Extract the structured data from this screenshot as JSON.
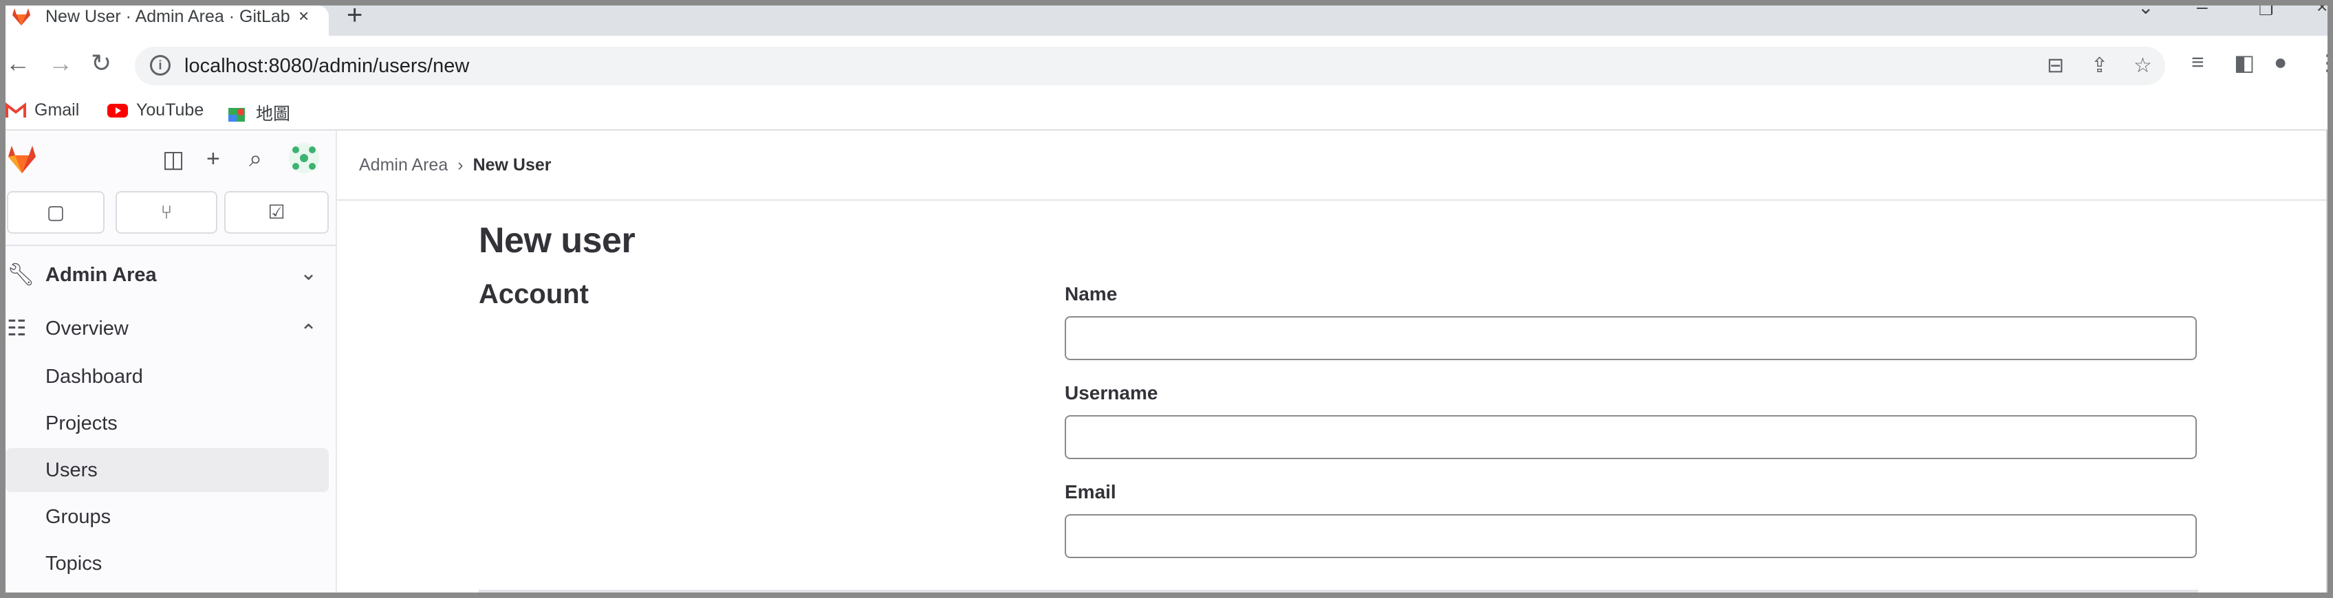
{
  "browser": {
    "tab_title": "New User · Admin Area · GitLab",
    "tab_close": "×",
    "new_tab": "+",
    "url": "localhost:8080/admin/users/new",
    "bookmarks": [
      {
        "label": "Gmail",
        "icon": "gmail-icon"
      },
      {
        "label": "YouTube",
        "icon": "youtube-icon"
      },
      {
        "label": "地圖",
        "icon": "maps-icon"
      }
    ]
  },
  "sidebar": {
    "section": {
      "label": "Admin Area",
      "icon": "admin-wrench-icon"
    },
    "overview": {
      "label": "Overview",
      "icon": "overview-grid-icon"
    },
    "items": [
      {
        "label": "Dashboard"
      },
      {
        "label": "Projects"
      },
      {
        "label": "Users"
      },
      {
        "label": "Groups"
      },
      {
        "label": "Topics"
      }
    ],
    "active_item": "Users"
  },
  "breadcrumb": {
    "parent": "Admin Area",
    "separator": "›",
    "current": "New User"
  },
  "main": {
    "page_title": "New user",
    "section_title": "Account",
    "fields": [
      {
        "label": "Name",
        "value": ""
      },
      {
        "label": "Username",
        "value": ""
      },
      {
        "label": "Email",
        "value": ""
      }
    ]
  },
  "colors": {
    "gitlab_orange": "#e24329",
    "active_item_bg": "#ececef"
  }
}
